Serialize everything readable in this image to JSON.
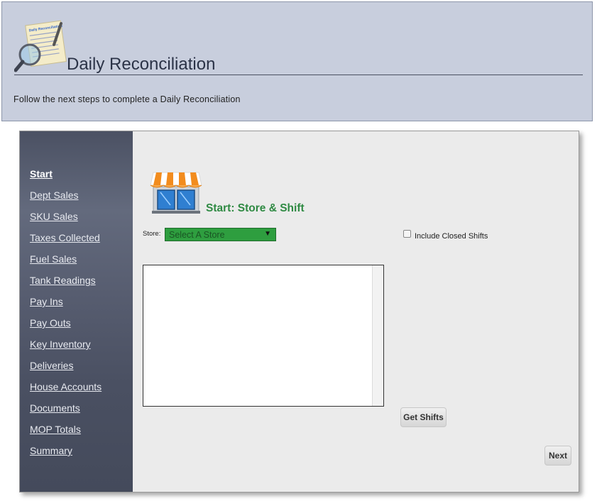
{
  "header": {
    "title": "Daily Reconciliation",
    "subtitle": "Follow the next steps to complete a Daily Reconciliation",
    "icon": "magnifier-document-icon",
    "icon_doc_heading": "Daily Reconciliation"
  },
  "sidebar": {
    "items": [
      {
        "label": "Start",
        "active": true
      },
      {
        "label": "Dept Sales"
      },
      {
        "label": "SKU Sales"
      },
      {
        "label": "Taxes Collected"
      },
      {
        "label": "Fuel Sales"
      },
      {
        "label": "Tank Readings"
      },
      {
        "label": "Pay Ins"
      },
      {
        "label": "Pay Outs"
      },
      {
        "label": "Key Inventory"
      },
      {
        "label": "Deliveries"
      },
      {
        "label": "House Accounts"
      },
      {
        "label": "Documents"
      },
      {
        "label": "MOP Totals"
      },
      {
        "label": "Summary"
      }
    ]
  },
  "main": {
    "section_title": "Start: Store & Shift",
    "section_icon": "storefront-icon",
    "store_label": "Store:",
    "store_select_value": "Select A Store",
    "include_closed_label": "Include Closed Shifts",
    "include_closed_checked": false,
    "get_shifts_button": "Get Shifts",
    "next_button": "Next"
  },
  "colors": {
    "header_bg": "#c8cedd",
    "sidebar_bg": "#575d70",
    "accent_green": "#2f8a43",
    "select_green": "#2e9e3f"
  }
}
